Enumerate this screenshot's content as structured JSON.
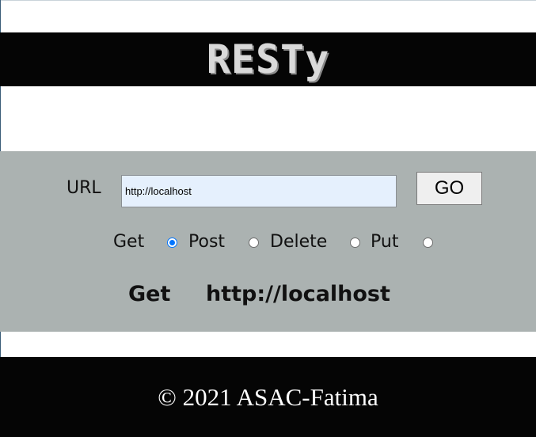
{
  "header": {
    "title": "RESTy"
  },
  "form": {
    "url_label": "URL",
    "url_value": "http://localhost",
    "go_label": "GO",
    "methods": [
      {
        "label": "Get",
        "checked": true
      },
      {
        "label": "Post",
        "checked": false
      },
      {
        "label": "Delete",
        "checked": false
      },
      {
        "label": "Put",
        "checked": false
      }
    ]
  },
  "result": {
    "method": "Get",
    "url": "http://localhost"
  },
  "footer": {
    "text": "© 2021 ASAC-Fatima"
  },
  "colors": {
    "header_bg": "#050505",
    "panel_bg": "#abb2b1",
    "input_bg": "#e5f0fd",
    "radio_accent": "#0075ff"
  }
}
